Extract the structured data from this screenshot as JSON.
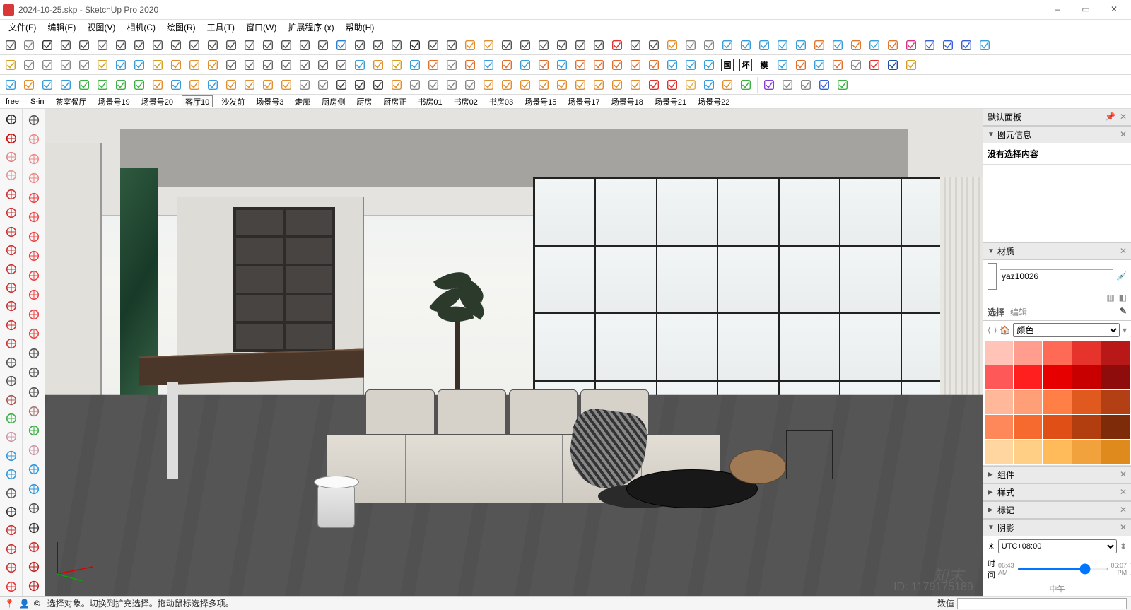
{
  "title": "2024-10-25.skp - SketchUp Pro 2020",
  "window_controls": {
    "minimize": "—",
    "maximize": "▭",
    "close": "✕"
  },
  "menus": [
    "文件(F)",
    "编辑(E)",
    "视图(V)",
    "相机(C)",
    "绘图(R)",
    "工具(T)",
    "窗口(W)",
    "扩展程序 (x)",
    "帮助(H)"
  ],
  "scene_tabs": [
    "free",
    "S-in",
    "茶室餐厅",
    "场景号19",
    "场景号20",
    "客厅10",
    "沙发前",
    "场景号3",
    "走廊",
    "厨房侧",
    "厨房",
    "厨房正",
    "书房01",
    "书房02",
    "书房03",
    "场景号15",
    "场景号17",
    "场景号18",
    "场景号21",
    "场景号22"
  ],
  "tray": {
    "default_panel": "默认面板",
    "entity_info": {
      "title": "图元信息",
      "body": "没有选择内容"
    },
    "materials": {
      "title": "材质",
      "name_value": "yaz10026",
      "tabs": {
        "select": "选择",
        "edit": "编辑"
      },
      "library_label": "颜色",
      "colors": [
        "#ffc3b8",
        "#ff9d8e",
        "#ff6a56",
        "#e6342c",
        "#b91818",
        "#ff5858",
        "#ff1f1f",
        "#e60000",
        "#c80000",
        "#8e0c0c",
        "#ffb99a",
        "#ff9f77",
        "#ff7f47",
        "#e05a1f",
        "#b24014",
        "#ff885a",
        "#f76a2f",
        "#e04f15",
        "#b23d0f",
        "#7e2b09",
        "#ffd6a0",
        "#ffcf85",
        "#ffba5a",
        "#f2a23c",
        "#de8a1c"
      ]
    },
    "components": "组件",
    "styles": "样式",
    "tags": "标记",
    "shadows": {
      "title": "阴影",
      "tz": "UTC+08:00",
      "time_label": "时间",
      "time_value": "15:32",
      "time_mid": "中午",
      "time_start": "06:43 AM",
      "time_end": "06:07 PM"
    }
  },
  "statusbar": {
    "hint": "选择对象。切换到扩充选择。拖动鼠标选择多项。",
    "measure_label": "数值",
    "measure_value": ""
  },
  "viewport": {
    "watermark": "知末",
    "id_watermark": "ID: 1179175189"
  },
  "toolbar1_icons": [
    {
      "n": "dynamic-comp-icon",
      "c": "#555"
    },
    {
      "n": "tape-icon",
      "c": "#888"
    },
    {
      "n": "line-icon",
      "c": "#333"
    },
    {
      "n": "arc-icon",
      "c": "#555"
    },
    {
      "n": "steps-icon",
      "c": "#555"
    },
    {
      "n": "section-icon",
      "c": "#666"
    },
    {
      "n": "wave-icon",
      "c": "#555"
    },
    {
      "n": "curve1-icon",
      "c": "#555"
    },
    {
      "n": "curve2-icon",
      "c": "#555"
    },
    {
      "n": "curve3-icon",
      "c": "#555"
    },
    {
      "n": "spiral-icon",
      "c": "#555"
    },
    {
      "n": "loop-icon",
      "c": "#555"
    },
    {
      "n": "undo-curve-icon",
      "c": "#555"
    },
    {
      "n": "bezier-icon",
      "c": "#555"
    },
    {
      "n": "circle-icon",
      "c": "#555"
    },
    {
      "n": "layers-icon",
      "c": "#555"
    },
    {
      "n": "cut-icon",
      "c": "#555"
    },
    {
      "n": "sandbox1-icon",
      "c": "#555"
    },
    {
      "n": "sandbox2-icon",
      "c": "#2a7dd4"
    },
    {
      "n": "sandbox3-icon",
      "c": "#555"
    },
    {
      "n": "terrain-icon",
      "c": "#555"
    },
    {
      "n": "follow-icon",
      "c": "#555"
    },
    {
      "n": "arrow-icon",
      "c": "#333"
    },
    {
      "n": "time-icon",
      "c": "#555"
    },
    {
      "n": "pan2-icon",
      "c": "#555"
    },
    {
      "n": "anim-icon",
      "c": "#e09030"
    },
    {
      "n": "anim2-icon",
      "c": "#e09030"
    },
    {
      "n": "spiral2-icon",
      "c": "#555"
    },
    {
      "n": "symmetry-icon",
      "c": "#555"
    },
    {
      "n": "grid1-icon",
      "c": "#555"
    },
    {
      "n": "grid2-icon",
      "c": "#555"
    },
    {
      "n": "matrix-icon",
      "c": "#555"
    },
    {
      "n": "panel-icon",
      "c": "#555"
    },
    {
      "n": "slash-icon",
      "c": "#e03030"
    },
    {
      "n": "offset-icon",
      "c": "#555"
    },
    {
      "n": "clean-icon",
      "c": "#555"
    },
    {
      "n": "box-icon",
      "c": "#e09030"
    },
    {
      "n": "gear1-icon",
      "c": "#888"
    },
    {
      "n": "gear2-icon",
      "c": "#888"
    },
    {
      "n": "cloud1-icon",
      "c": "#3a9dd8"
    },
    {
      "n": "cloud2-icon",
      "c": "#3a9dd8"
    },
    {
      "n": "cloud3-icon",
      "c": "#3a9dd8"
    },
    {
      "n": "cloud4-icon",
      "c": "#3a9dd8"
    },
    {
      "n": "cloud5-icon",
      "c": "#3a9dd8"
    },
    {
      "n": "frame1-icon",
      "c": "#e07830"
    },
    {
      "n": "frame2-icon",
      "c": "#3a9dd8"
    },
    {
      "n": "frame3-icon",
      "c": "#e07830"
    },
    {
      "n": "frame4-icon",
      "c": "#3a9dd8"
    },
    {
      "n": "frame5-icon",
      "c": "#e07830"
    },
    {
      "n": "shield-icon",
      "c": "#e03080"
    },
    {
      "n": "m-logo-icon",
      "c": "#3a60d8"
    },
    {
      "n": "user-icon",
      "c": "#3a60d8"
    },
    {
      "n": "help-icon",
      "c": "#3a60d8"
    },
    {
      "n": "gear-icon",
      "c": "#3a9dd8"
    }
  ],
  "toolbar2_icons": [
    {
      "n": "iso-icon",
      "c": "#d4a020"
    },
    {
      "n": "top-icon",
      "c": "#888"
    },
    {
      "n": "front-icon",
      "c": "#888"
    },
    {
      "n": "right-icon",
      "c": "#888"
    },
    {
      "n": "back-icon",
      "c": "#888"
    },
    {
      "n": "perspective-icon",
      "c": "#d4a020"
    },
    {
      "n": "face-style1-icon",
      "c": "#3a9dd8"
    },
    {
      "n": "face-style2-icon",
      "c": "#3a9dd8"
    },
    {
      "n": "face-style3-icon",
      "c": "#d4a020"
    },
    {
      "n": "undo-icon",
      "c": "#e09030"
    },
    {
      "n": "redo-icon",
      "c": "#e09030"
    },
    {
      "n": "paste-icon",
      "c": "#e09030"
    },
    {
      "n": "house1-icon",
      "c": "#666"
    },
    {
      "n": "house2-icon",
      "c": "#666"
    },
    {
      "n": "house3-icon",
      "c": "#666"
    },
    {
      "n": "house4-icon",
      "c": "#666"
    },
    {
      "n": "house5-icon",
      "c": "#666"
    },
    {
      "n": "house6-icon",
      "c": "#666"
    },
    {
      "n": "house7-icon",
      "c": "#666"
    },
    {
      "n": "cube-blue-icon",
      "c": "#3a9dd8"
    },
    {
      "n": "cube-orange-icon",
      "c": "#e09030"
    },
    {
      "n": "cube-yellow-icon",
      "c": "#d4a020"
    },
    {
      "n": "erase-blue-icon",
      "c": "#3a9dd8"
    },
    {
      "n": "diag-line-icon",
      "c": "#e07030"
    },
    {
      "n": "dash-line-icon",
      "c": "#888"
    },
    {
      "n": "sq1-icon",
      "c": "#e07030"
    },
    {
      "n": "sq2-icon",
      "c": "#3a9dd8"
    },
    {
      "n": "sq3-icon",
      "c": "#e07030"
    },
    {
      "n": "sq4-icon",
      "c": "#3a9dd8"
    },
    {
      "n": "sq5-icon",
      "c": "#e07030"
    },
    {
      "n": "sq6-icon",
      "c": "#3a9dd8"
    },
    {
      "n": "panel1-icon",
      "c": "#e07030"
    },
    {
      "n": "panel2-icon",
      "c": "#e07030"
    },
    {
      "n": "panel3-icon",
      "c": "#e07030"
    },
    {
      "n": "panel4-icon",
      "c": "#e07030"
    },
    {
      "n": "panel5-icon",
      "c": "#e07030"
    },
    {
      "n": "crop1-icon",
      "c": "#3a9dd8"
    },
    {
      "n": "crop2-icon",
      "c": "#3a9dd8"
    },
    {
      "n": "crop3-icon",
      "c": "#3a9dd8"
    },
    {
      "n": "badge1-icon",
      "c": "#333",
      "t": "国"
    },
    {
      "n": "badge2-icon",
      "c": "#333",
      "t": "坏"
    },
    {
      "n": "badge3-icon",
      "c": "#333",
      "t": "模"
    },
    {
      "n": "outline1-icon",
      "c": "#3a9dd8"
    },
    {
      "n": "outline2-icon",
      "c": "#e07030"
    },
    {
      "n": "outline3-icon",
      "c": "#3a9dd8"
    },
    {
      "n": "outline4-icon",
      "c": "#e07030"
    },
    {
      "n": "outline5-icon",
      "c": "#888"
    },
    {
      "n": "life-ring-icon",
      "c": "#e03030"
    },
    {
      "n": "diamond-icon",
      "c": "#2050a0"
    },
    {
      "n": "gold-cube-icon",
      "c": "#d4a020"
    }
  ],
  "toolbar3_icons": [
    {
      "n": "camera-icon",
      "c": "#3a9dd8"
    },
    {
      "n": "target-icon",
      "c": "#e09030"
    },
    {
      "n": "target2-icon",
      "c": "#3a9dd8"
    },
    {
      "n": "target3-icon",
      "c": "#3a9dd8"
    },
    {
      "n": "gbox1-icon",
      "c": "#3cb043"
    },
    {
      "n": "gbox2-icon",
      "c": "#3cb043"
    },
    {
      "n": "gbox3-icon",
      "c": "#3cb043"
    },
    {
      "n": "gstack-icon",
      "c": "#3cb043"
    },
    {
      "n": "ggear-icon",
      "c": "#e09030"
    },
    {
      "n": "panel-open-icon",
      "c": "#3a9dd8"
    },
    {
      "n": "panel-close-icon",
      "c": "#e09030"
    },
    {
      "n": "panel-gear-icon",
      "c": "#3a9dd8"
    },
    {
      "n": "oic-1",
      "c": "#e09030"
    },
    {
      "n": "oic-2",
      "c": "#e09030"
    },
    {
      "n": "oic-3",
      "c": "#e09030"
    },
    {
      "n": "oic-4",
      "c": "#e09030"
    },
    {
      "n": "oic-5",
      "c": "#888"
    },
    {
      "n": "oic-6",
      "c": "#888"
    },
    {
      "n": "dark1-icon",
      "c": "#444"
    },
    {
      "n": "dark2-icon",
      "c": "#444"
    },
    {
      "n": "dark3-icon",
      "c": "#444"
    },
    {
      "n": "shield2-icon",
      "c": "#e09030"
    },
    {
      "n": "gear3-icon",
      "c": "#888"
    },
    {
      "n": "hex1-icon",
      "c": "#888"
    },
    {
      "n": "hex2-icon",
      "c": "#888"
    },
    {
      "n": "hex3-icon",
      "c": "#888"
    },
    {
      "n": "ow1",
      "c": "#e09030"
    },
    {
      "n": "ow2",
      "c": "#e09030"
    },
    {
      "n": "ow3",
      "c": "#e09030"
    },
    {
      "n": "ow4",
      "c": "#e09030"
    },
    {
      "n": "ow5",
      "c": "#e09030"
    },
    {
      "n": "ow6",
      "c": "#e09030"
    },
    {
      "n": "ow7",
      "c": "#e09030"
    },
    {
      "n": "ow8",
      "c": "#e09030"
    },
    {
      "n": "sel-cursor-icon",
      "c": "#e09030"
    },
    {
      "n": "cut2-icon",
      "c": "#e03030"
    },
    {
      "n": "split-icon",
      "c": "#e03030"
    },
    {
      "n": "hand-icon",
      "c": "#e0b050"
    },
    {
      "n": "bluestrip-icon",
      "c": "#3a9dd8"
    },
    {
      "n": "mlogo2-icon",
      "c": "#e09030"
    },
    {
      "n": "greenflag-icon",
      "c": "#3cb043"
    },
    {
      "n": "|",
      "c": ""
    },
    {
      "n": "purple1-icon",
      "c": "#8a3cd8"
    },
    {
      "n": "ring1-icon",
      "c": "#888"
    },
    {
      "n": "ring2-icon",
      "c": "#888"
    },
    {
      "n": "blue-sq-icon",
      "c": "#3a60d8"
    },
    {
      "n": "gradient-icon",
      "c": "#3cb043"
    }
  ],
  "left_tools_a": [
    {
      "n": "select-icon",
      "c": "#222"
    },
    {
      "n": "line-tool-icon",
      "c": "#c00"
    },
    {
      "n": "eraser-icon",
      "c": "#d88"
    },
    {
      "n": "rectangle-tool-icon",
      "c": "#d99"
    },
    {
      "n": "circle-tool-icon",
      "c": "#c33"
    },
    {
      "n": "polygon-tool-icon",
      "c": "#c33"
    },
    {
      "n": "arc-tool-icon",
      "c": "#c33"
    },
    {
      "n": "move-tool-icon",
      "c": "#c33"
    },
    {
      "n": "pushpull-icon",
      "c": "#c33"
    },
    {
      "n": "rotate-tool-icon",
      "c": "#c33"
    },
    {
      "n": "followme-icon",
      "c": "#c33"
    },
    {
      "n": "scale-tool-icon",
      "c": "#c33"
    },
    {
      "n": "offset-tool-icon",
      "c": "#c33"
    },
    {
      "n": "tape-tool-icon",
      "c": "#555"
    },
    {
      "n": "text-tool-icon",
      "c": "#555"
    },
    {
      "n": "paint-tool-icon",
      "c": "#a55"
    },
    {
      "n": "orbit-icon",
      "c": "#3cb043"
    },
    {
      "n": "pan-icon",
      "c": "#c9a"
    },
    {
      "n": "zoom-icon",
      "c": "#39d"
    },
    {
      "n": "zoom-extents-icon",
      "c": "#39d"
    },
    {
      "n": "prev-view-icon",
      "c": "#555"
    },
    {
      "n": "walk-icon",
      "c": "#333"
    },
    {
      "n": "section-tool-icon",
      "c": "#c33"
    },
    {
      "n": "axes-tool-icon",
      "c": "#c33"
    },
    {
      "n": "dims-icon",
      "c": "#c33"
    },
    {
      "n": "red-panel-icon",
      "c": "#e33"
    }
  ],
  "left_tools_b": [
    {
      "n": "lasso-icon",
      "c": "#555"
    },
    {
      "n": "pencil2-icon",
      "c": "#e88"
    },
    {
      "n": "freehand-icon",
      "c": "#e88"
    },
    {
      "n": "rect2-icon",
      "c": "#e88"
    },
    {
      "n": "pie-icon",
      "c": "#e44"
    },
    {
      "n": "arc2-icon",
      "c": "#e44"
    },
    {
      "n": "arc3-icon",
      "c": "#e44"
    },
    {
      "n": "rotate2-icon",
      "c": "#e44"
    },
    {
      "n": "pushpull2-icon",
      "c": "#e44"
    },
    {
      "n": "scale2-icon",
      "c": "#e44"
    },
    {
      "n": "intersect-icon",
      "c": "#e44"
    },
    {
      "n": "protractor-icon",
      "c": "#e44"
    },
    {
      "n": "dimension-icon",
      "c": "#555"
    },
    {
      "n": "label-icon",
      "c": "#555"
    },
    {
      "n": "3dtext-icon",
      "c": "#555"
    },
    {
      "n": "position-icon",
      "c": "#a77"
    },
    {
      "n": "look-icon",
      "c": "#3cb043"
    },
    {
      "n": "hand2-icon",
      "c": "#c9a"
    },
    {
      "n": "zoom-win-icon",
      "c": "#39d"
    },
    {
      "n": "zoom-prev-icon",
      "c": "#39d"
    },
    {
      "n": "next-view-icon",
      "c": "#555"
    },
    {
      "n": "walk2-icon",
      "c": "#333"
    },
    {
      "n": "section2-icon",
      "c": "#c33"
    },
    {
      "n": "ruby-icon",
      "c": "#b22"
    },
    {
      "n": "diamond2-icon",
      "c": "#b22"
    }
  ]
}
